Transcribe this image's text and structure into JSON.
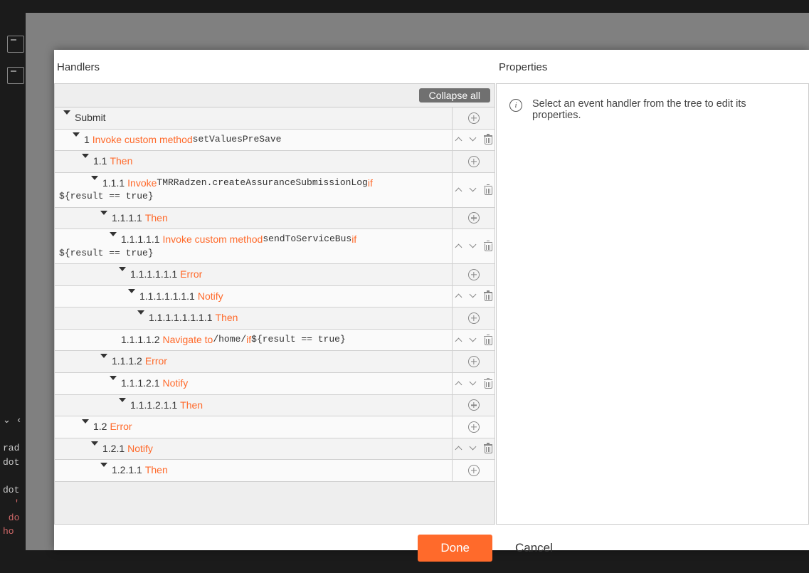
{
  "handlers": {
    "title": "Handlers",
    "collapse_all": "Collapse all"
  },
  "properties": {
    "title": "Properties",
    "empty_message": "Select an event handler from the tree to edit its properties."
  },
  "footer": {
    "done": "Done",
    "cancel": "Cancel"
  },
  "tree": [
    {
      "indent": 0,
      "caret": true,
      "num": "",
      "plainLabel": "Submit",
      "controls": "plus"
    },
    {
      "indent": 1,
      "caret": true,
      "num": "1",
      "action": "Invoke custom method",
      "codeAfter": " setValuesPreSave",
      "controls": "updown-trash"
    },
    {
      "indent": 2,
      "caret": true,
      "num": "1.1",
      "action": "Then",
      "controls": "plus"
    },
    {
      "indent": 3,
      "caret": true,
      "num": "1.1.1",
      "action": "Invoke",
      "codeAfter": " TMRRadzen.createAssuranceSubmissionLog ",
      "action2": "if",
      "codeAfter2": " ${result == true}",
      "wrap": true,
      "controls": "updown-trash"
    },
    {
      "indent": 4,
      "caret": true,
      "num": "1.1.1.1",
      "action": "Then",
      "controls": "plus"
    },
    {
      "indent": 5,
      "caret": true,
      "num": "1.1.1.1.1",
      "action": "Invoke custom method",
      "codeAfter": " sendToServiceBus ",
      "action2": "if",
      "codeAfter2": " ${result == true}",
      "controls": "updown-trash"
    },
    {
      "indent": 6,
      "caret": true,
      "num": "1.1.1.1.1.1",
      "action": "Error",
      "controls": "plus"
    },
    {
      "indent": 7,
      "caret": true,
      "num": "1.1.1.1.1.1.1",
      "action": "Notify",
      "controls": "updown-trash"
    },
    {
      "indent": 8,
      "caret": true,
      "num": "1.1.1.1.1.1.1.1",
      "action": "Then",
      "controls": "plus"
    },
    {
      "indent": 5,
      "caret": false,
      "num": "1.1.1.1.2",
      "action": "Navigate to",
      "codeAfter": " /home/ ",
      "action2": " if",
      "codeAfter2": " ${result == true}",
      "controls": "updown-trash"
    },
    {
      "indent": 4,
      "caret": true,
      "num": "1.1.1.2",
      "action": "Error",
      "controls": "plus"
    },
    {
      "indent": 5,
      "caret": true,
      "num": "1.1.1.2.1",
      "action": "Notify",
      "controls": "updown-trash"
    },
    {
      "indent": 6,
      "caret": true,
      "num": "1.1.1.2.1.1",
      "action": "Then",
      "controls": "plus"
    },
    {
      "indent": 2,
      "caret": true,
      "num": "1.2",
      "action": "Error",
      "controls": "plus"
    },
    {
      "indent": 3,
      "caret": true,
      "num": "1.2.1",
      "action": "Notify",
      "controls": "updown-trash"
    },
    {
      "indent": 4,
      "caret": true,
      "num": "1.2.1.1",
      "action": "Then",
      "controls": "plus"
    }
  ]
}
